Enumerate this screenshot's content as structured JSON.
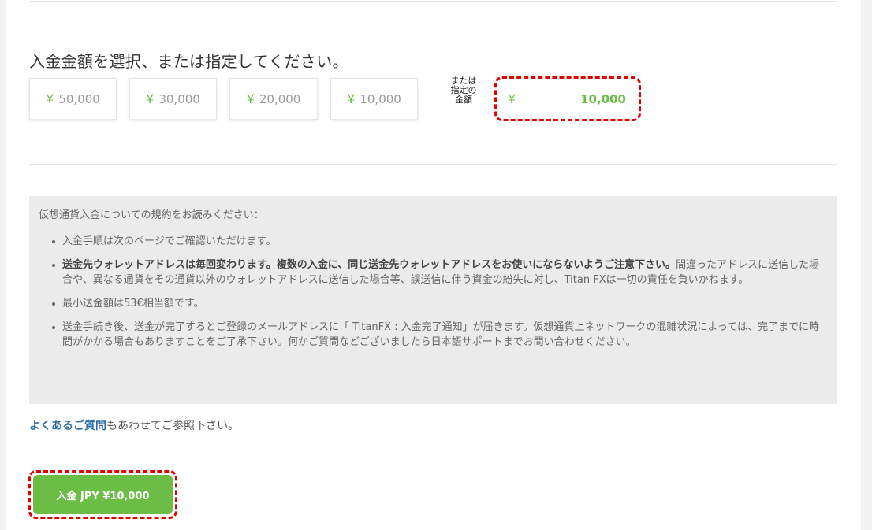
{
  "heading": "入金金額を選択、または指定してください。",
  "currency_symbol": "¥",
  "presets": [
    {
      "value": "50,000"
    },
    {
      "value": "30,000"
    },
    {
      "value": "20,000"
    },
    {
      "value": "10,000"
    }
  ],
  "custom_amount": {
    "label": "または指定の金額",
    "label_lines": [
      "または",
      "指定の",
      "金額"
    ],
    "value": "10,000"
  },
  "terms": {
    "title": "仮想通貨入金についての規約をお読みください：",
    "items": [
      {
        "bold": "",
        "text": "入金手順は次のページでご確認いただけます。"
      },
      {
        "bold": "送金先ウォレットアドレスは毎回変わります。複数の入金に、同じ送金先ウォレットアドレスをお使いにならないようご注意下さい。",
        "text": "間違ったアドレスに送信した場合や、異なる通貨をその通貨以外のウォレットアドレスに送信した場合等、誤送信に伴う資金の紛失に対し、Titan FXは一切の責任を負いかねます。"
      },
      {
        "bold": "",
        "text": "最小送金額は53€相当額です。"
      },
      {
        "bold": "",
        "text": "送金手続き後、送金が完了するとご登録のメールアドレスに「 TitanFX : 入金完了通知」が届きます。仮想通貨上ネットワークの混雑状況によっては、完了までに時間がかかる場合もありますことをご了承下さい。何かご質問などございましたら日本語サポートまでお問い合わせください。"
      }
    ]
  },
  "faq": {
    "link_label": "よくあるご質問",
    "suffix": "もあわせてご参照下さい。"
  },
  "submit_label": "入金 JPY ¥10,000",
  "colors": {
    "accent_green": "#6cbd45",
    "highlight_red": "#e00000",
    "link_blue": "#2e6da4"
  }
}
